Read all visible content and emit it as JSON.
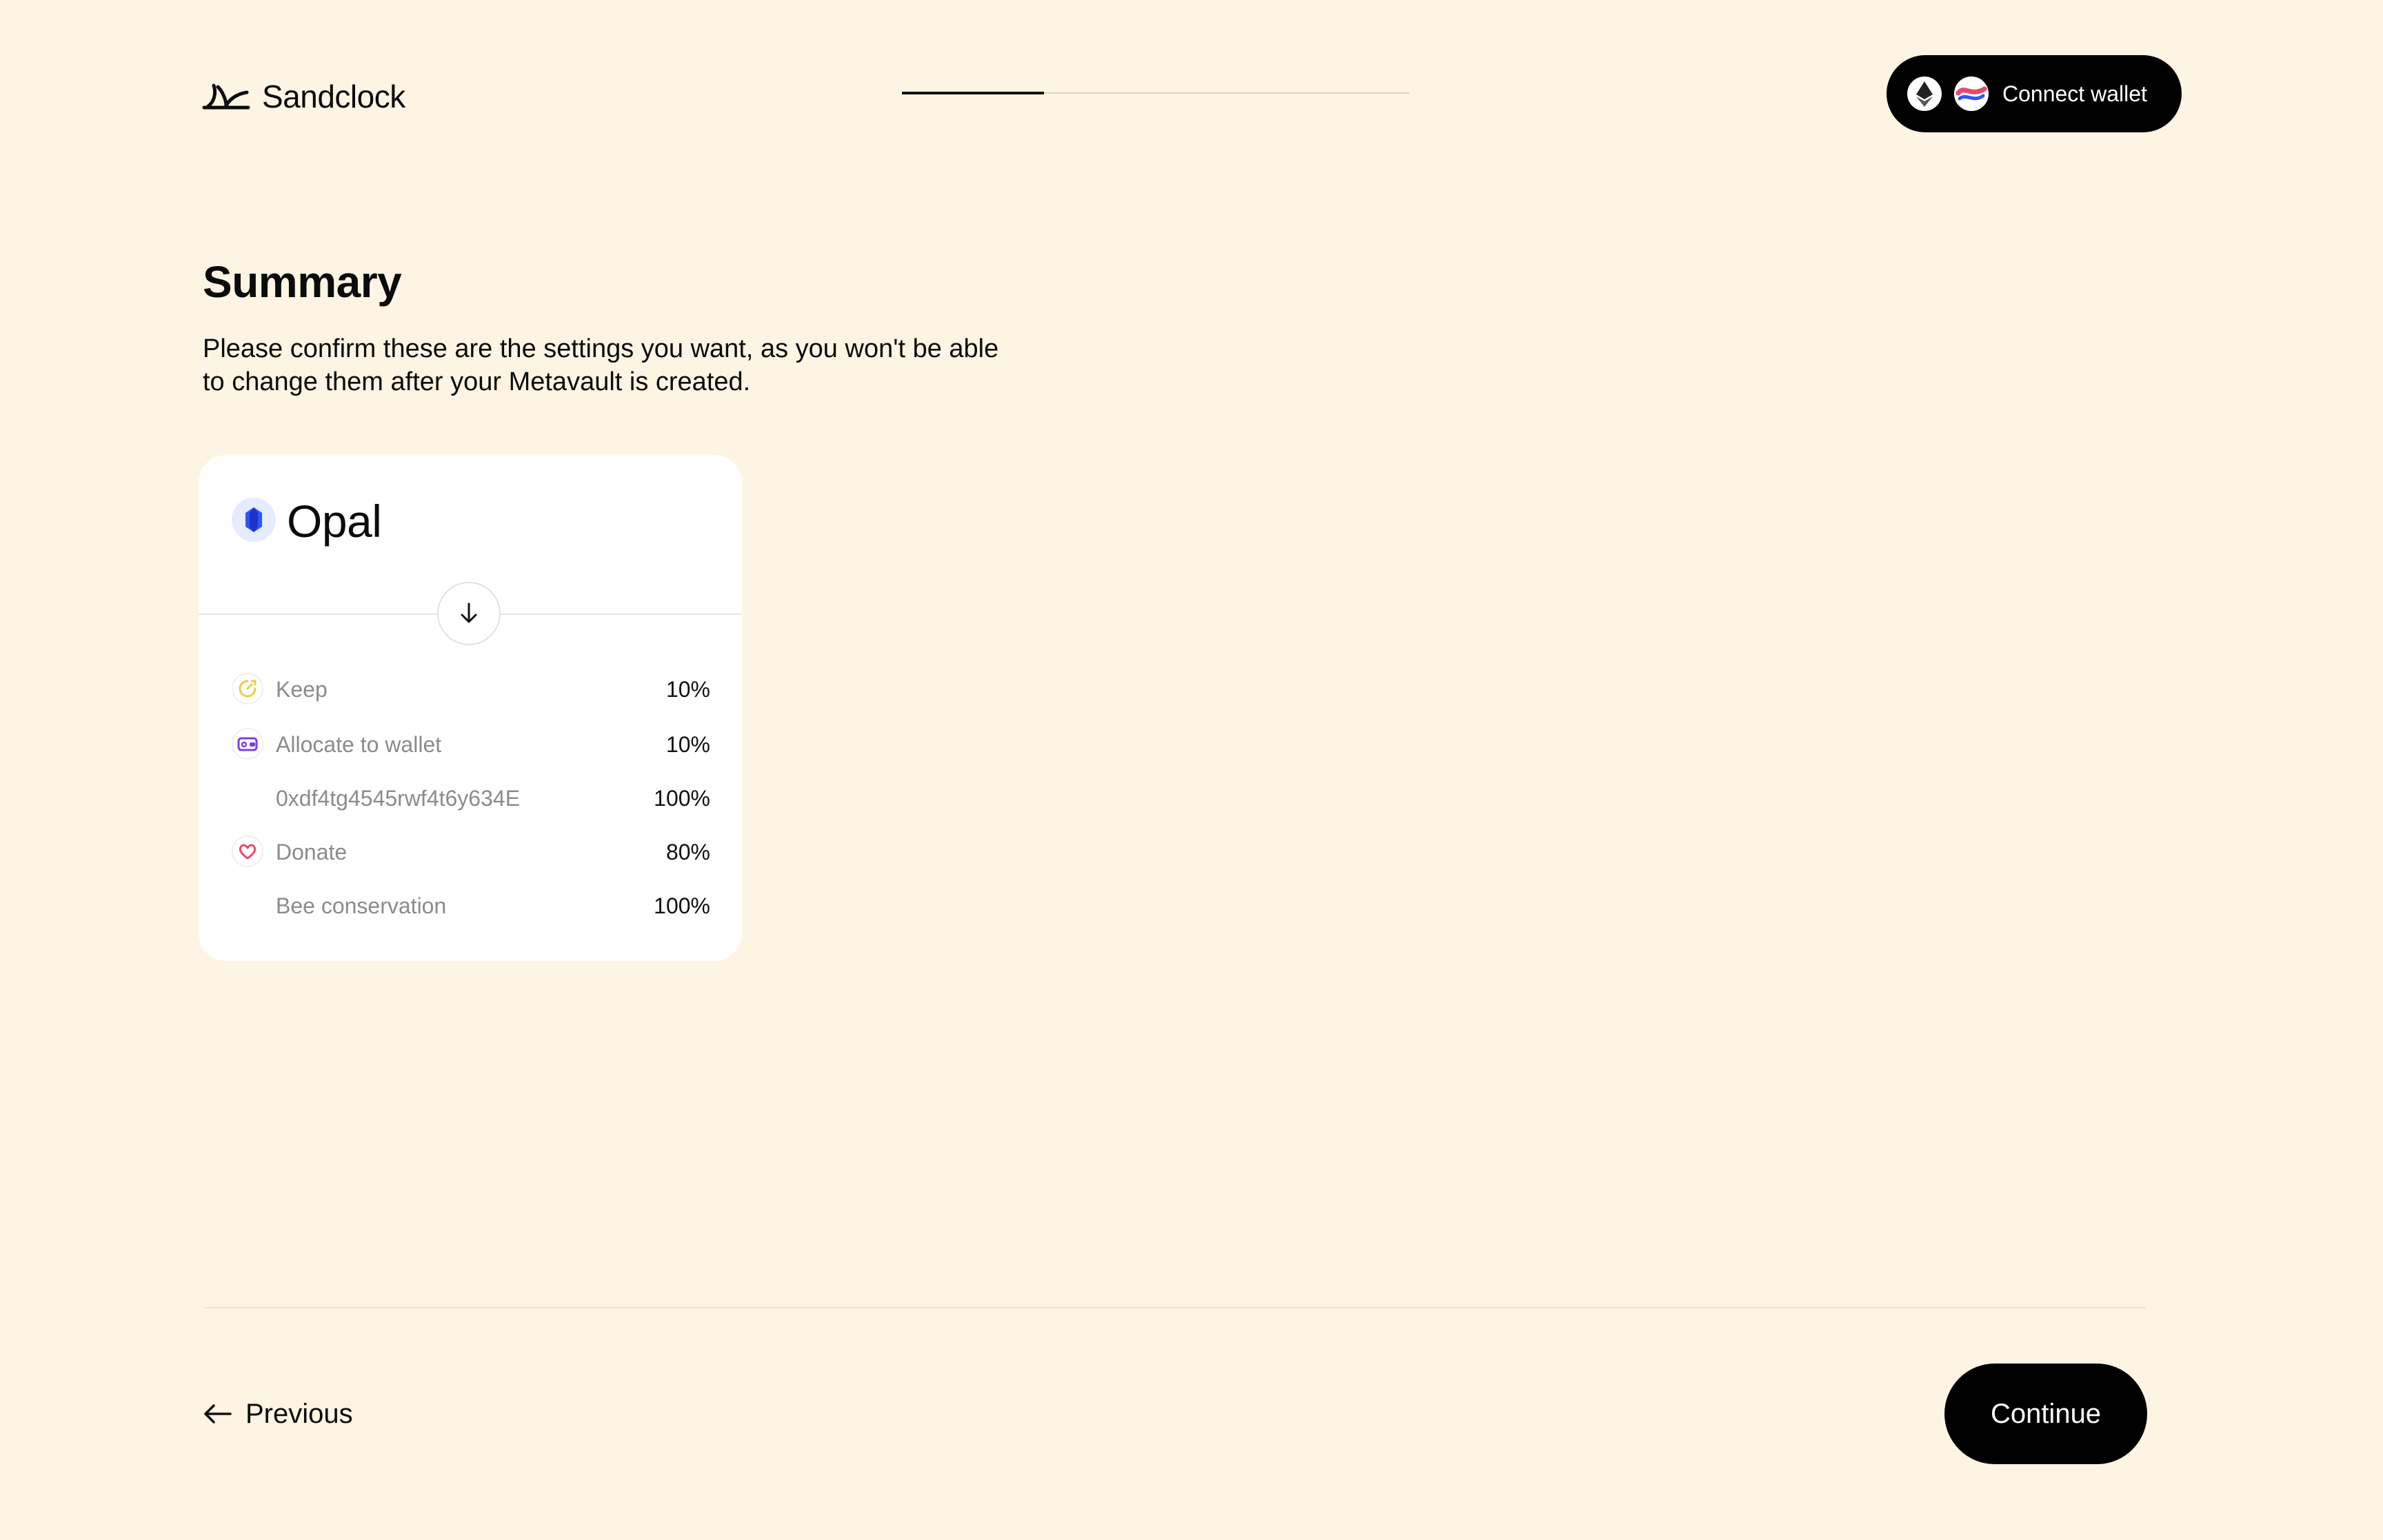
{
  "header": {
    "brand": "Sandclock",
    "progress_fraction": 0.28,
    "wallet_button": "Connect wallet",
    "chain_icons": [
      "ethereum-icon",
      "optimism-icon"
    ]
  },
  "main": {
    "title": "Summary",
    "description": "Please confirm these are the settings you want, as you won't be able to change them after your Metavault is created."
  },
  "vault": {
    "name": "Opal",
    "rows": [
      {
        "icon": "keep-icon",
        "label": "Keep",
        "value": "10%"
      },
      {
        "icon": "wallet-icon",
        "label": "Allocate to wallet",
        "value": "10%"
      },
      {
        "icon": "",
        "label": "0xdf4tg4545rwf4t6y634E",
        "value": "100%"
      },
      {
        "icon": "heart-icon",
        "label": "Donate",
        "value": "80%"
      },
      {
        "icon": "",
        "label": "Bee conservation",
        "value": "100%"
      }
    ]
  },
  "footer": {
    "previous": "Previous",
    "continue": "Continue"
  },
  "colors": {
    "background": "#fdf4e3",
    "keep_accent": "#f2c94c",
    "wallet_accent": "#7b3fe4",
    "donate_accent": "#e8486a",
    "vault_accent": "#2f55ff"
  }
}
